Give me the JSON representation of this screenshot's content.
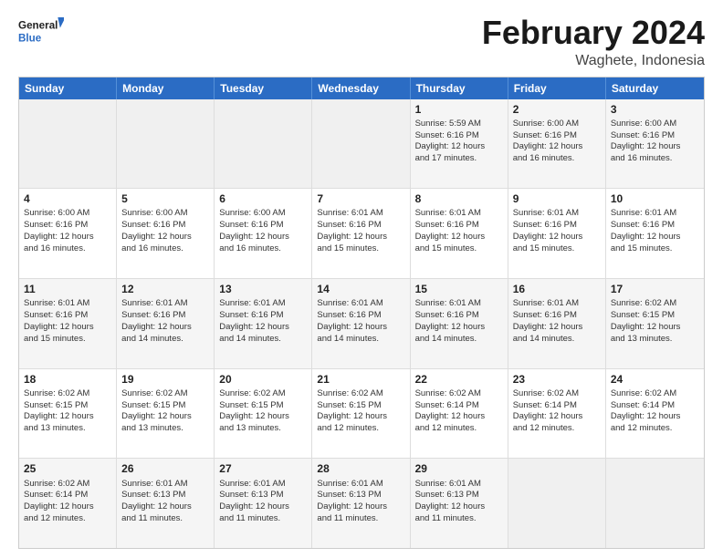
{
  "logo": {
    "line1": "General",
    "line2": "Blue"
  },
  "header": {
    "title": "February 2024",
    "location": "Waghete, Indonesia"
  },
  "weekdays": [
    "Sunday",
    "Monday",
    "Tuesday",
    "Wednesday",
    "Thursday",
    "Friday",
    "Saturday"
  ],
  "rows": [
    [
      {
        "day": "",
        "info": ""
      },
      {
        "day": "",
        "info": ""
      },
      {
        "day": "",
        "info": ""
      },
      {
        "day": "",
        "info": ""
      },
      {
        "day": "1",
        "info": "Sunrise: 5:59 AM\nSunset: 6:16 PM\nDaylight: 12 hours\nand 17 minutes."
      },
      {
        "day": "2",
        "info": "Sunrise: 6:00 AM\nSunset: 6:16 PM\nDaylight: 12 hours\nand 16 minutes."
      },
      {
        "day": "3",
        "info": "Sunrise: 6:00 AM\nSunset: 6:16 PM\nDaylight: 12 hours\nand 16 minutes."
      }
    ],
    [
      {
        "day": "4",
        "info": "Sunrise: 6:00 AM\nSunset: 6:16 PM\nDaylight: 12 hours\nand 16 minutes."
      },
      {
        "day": "5",
        "info": "Sunrise: 6:00 AM\nSunset: 6:16 PM\nDaylight: 12 hours\nand 16 minutes."
      },
      {
        "day": "6",
        "info": "Sunrise: 6:00 AM\nSunset: 6:16 PM\nDaylight: 12 hours\nand 16 minutes."
      },
      {
        "day": "7",
        "info": "Sunrise: 6:01 AM\nSunset: 6:16 PM\nDaylight: 12 hours\nand 15 minutes."
      },
      {
        "day": "8",
        "info": "Sunrise: 6:01 AM\nSunset: 6:16 PM\nDaylight: 12 hours\nand 15 minutes."
      },
      {
        "day": "9",
        "info": "Sunrise: 6:01 AM\nSunset: 6:16 PM\nDaylight: 12 hours\nand 15 minutes."
      },
      {
        "day": "10",
        "info": "Sunrise: 6:01 AM\nSunset: 6:16 PM\nDaylight: 12 hours\nand 15 minutes."
      }
    ],
    [
      {
        "day": "11",
        "info": "Sunrise: 6:01 AM\nSunset: 6:16 PM\nDaylight: 12 hours\nand 15 minutes."
      },
      {
        "day": "12",
        "info": "Sunrise: 6:01 AM\nSunset: 6:16 PM\nDaylight: 12 hours\nand 14 minutes."
      },
      {
        "day": "13",
        "info": "Sunrise: 6:01 AM\nSunset: 6:16 PM\nDaylight: 12 hours\nand 14 minutes."
      },
      {
        "day": "14",
        "info": "Sunrise: 6:01 AM\nSunset: 6:16 PM\nDaylight: 12 hours\nand 14 minutes."
      },
      {
        "day": "15",
        "info": "Sunrise: 6:01 AM\nSunset: 6:16 PM\nDaylight: 12 hours\nand 14 minutes."
      },
      {
        "day": "16",
        "info": "Sunrise: 6:01 AM\nSunset: 6:16 PM\nDaylight: 12 hours\nand 14 minutes."
      },
      {
        "day": "17",
        "info": "Sunrise: 6:02 AM\nSunset: 6:15 PM\nDaylight: 12 hours\nand 13 minutes."
      }
    ],
    [
      {
        "day": "18",
        "info": "Sunrise: 6:02 AM\nSunset: 6:15 PM\nDaylight: 12 hours\nand 13 minutes."
      },
      {
        "day": "19",
        "info": "Sunrise: 6:02 AM\nSunset: 6:15 PM\nDaylight: 12 hours\nand 13 minutes."
      },
      {
        "day": "20",
        "info": "Sunrise: 6:02 AM\nSunset: 6:15 PM\nDaylight: 12 hours\nand 13 minutes."
      },
      {
        "day": "21",
        "info": "Sunrise: 6:02 AM\nSunset: 6:15 PM\nDaylight: 12 hours\nand 12 minutes."
      },
      {
        "day": "22",
        "info": "Sunrise: 6:02 AM\nSunset: 6:14 PM\nDaylight: 12 hours\nand 12 minutes."
      },
      {
        "day": "23",
        "info": "Sunrise: 6:02 AM\nSunset: 6:14 PM\nDaylight: 12 hours\nand 12 minutes."
      },
      {
        "day": "24",
        "info": "Sunrise: 6:02 AM\nSunset: 6:14 PM\nDaylight: 12 hours\nand 12 minutes."
      }
    ],
    [
      {
        "day": "25",
        "info": "Sunrise: 6:02 AM\nSunset: 6:14 PM\nDaylight: 12 hours\nand 12 minutes."
      },
      {
        "day": "26",
        "info": "Sunrise: 6:01 AM\nSunset: 6:13 PM\nDaylight: 12 hours\nand 11 minutes."
      },
      {
        "day": "27",
        "info": "Sunrise: 6:01 AM\nSunset: 6:13 PM\nDaylight: 12 hours\nand 11 minutes."
      },
      {
        "day": "28",
        "info": "Sunrise: 6:01 AM\nSunset: 6:13 PM\nDaylight: 12 hours\nand 11 minutes."
      },
      {
        "day": "29",
        "info": "Sunrise: 6:01 AM\nSunset: 6:13 PM\nDaylight: 12 hours\nand 11 minutes."
      },
      {
        "day": "",
        "info": ""
      },
      {
        "day": "",
        "info": ""
      }
    ]
  ]
}
